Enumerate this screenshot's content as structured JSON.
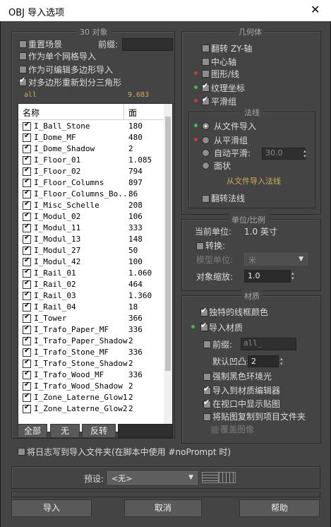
{
  "window": {
    "title": "OBJ 导入选项",
    "close": "✕"
  },
  "object_panel": {
    "title": "30 对象",
    "reset_scene": "重置场景",
    "prefix_label": "前缀:",
    "prefix_value": "",
    "single_mesh": "作为单个网格导入",
    "editable_poly": "作为可编辑多边形导入",
    "retriangulate": "对多边形重新划分三角形",
    "all_label": "all",
    "all_value": "9.683",
    "columns": {
      "name": "名称",
      "faces": "面"
    },
    "rows": [
      {
        "name": "I_Ball_Stone",
        "faces": "180"
      },
      {
        "name": "I_Dome_MF",
        "faces": "480"
      },
      {
        "name": "I_Dome_Shadow",
        "faces": "2"
      },
      {
        "name": "I_Floor_01",
        "faces": "1.085"
      },
      {
        "name": "I_Floor_02",
        "faces": "794"
      },
      {
        "name": "I_Floor_Columns",
        "faces": "897"
      },
      {
        "name": "I_Floor_Columns_Bo...",
        "faces": "86"
      },
      {
        "name": "I_Misc_Schelle",
        "faces": "208"
      },
      {
        "name": "I_Modul_02",
        "faces": "106"
      },
      {
        "name": "I_Modul_11",
        "faces": "333"
      },
      {
        "name": "I_Modul_13",
        "faces": "148"
      },
      {
        "name": "I_Modul_27",
        "faces": "50"
      },
      {
        "name": "I_Modul_42",
        "faces": "100"
      },
      {
        "name": "I_Rail_01",
        "faces": "1.060"
      },
      {
        "name": "I_Rail_02",
        "faces": "464"
      },
      {
        "name": "I_Rail_03",
        "faces": "1.360"
      },
      {
        "name": "I_Rail_04",
        "faces": "18"
      },
      {
        "name": "I_Tower",
        "faces": "366"
      },
      {
        "name": "I_Trafo_Paper_MF",
        "faces": "336"
      },
      {
        "name": "I_Trafo_Paper_Shadow",
        "faces": "2"
      },
      {
        "name": "I_Trafo_Stone_MF",
        "faces": "336"
      },
      {
        "name": "I_Trafo_Stone_Shadow",
        "faces": "2"
      },
      {
        "name": "I_Trafo_Wood_MF",
        "faces": "336"
      },
      {
        "name": "I_Trafo_Wood_Shadow",
        "faces": "2"
      },
      {
        "name": "I_Zone_Laterne_Glow1",
        "faces": "2"
      },
      {
        "name": "I_Zone_Laterne_Glow2",
        "faces": "2"
      }
    ],
    "btn_all": "全部",
    "btn_none": "无",
    "btn_invert": "反转"
  },
  "geometry_panel": {
    "title": "几何体",
    "flip_zy": "翻转 ZY-轴",
    "center_pivot": "中心轴",
    "shapes_lines": "图形/线",
    "texture_coords": "纹理坐标",
    "smoothing_groups": "平滑组"
  },
  "normals_panel": {
    "title": "法线",
    "from_file": "从文件导入",
    "from_smoothing": "从平滑组",
    "auto_smooth": "自动平滑:",
    "auto_smooth_value": "30.0",
    "faceted": "面状",
    "import_note": "从文件导入法线",
    "flip_normals": "翻转法线"
  },
  "units_panel": {
    "title": "单位/比例",
    "current_units_label": "当前单位:",
    "current_units_value": "1.0 英寸",
    "convert": "转换:",
    "model_units_label": "模型单位:",
    "model_units_value": "米",
    "object_scale_label": "对象缩放:",
    "object_scale_value": "1.0"
  },
  "material_panel": {
    "title": "材质",
    "unique_wire_color": "独特的线框颜色",
    "import_materials": "导入材质",
    "prefix_label": "前缀:",
    "prefix_value": "all_",
    "default_bump_label": "默认凹凸:",
    "default_bump_value": "2",
    "force_black_ambient": "强制黑色环境光",
    "import_to_editor": "导入到材质编辑器",
    "show_maps_viewport": "在视口中显示贴图",
    "copy_maps": "将贴图复制到项目文件夹",
    "overwrite_images": "覆盖图像"
  },
  "log_option": "将日志写到导入文件夹(在脚本中使用 #noPrompt 时)",
  "preset": {
    "label": "预设:",
    "value": "<无>"
  },
  "buttons": {
    "import": "导入",
    "cancel": "取消",
    "help": "帮助"
  }
}
